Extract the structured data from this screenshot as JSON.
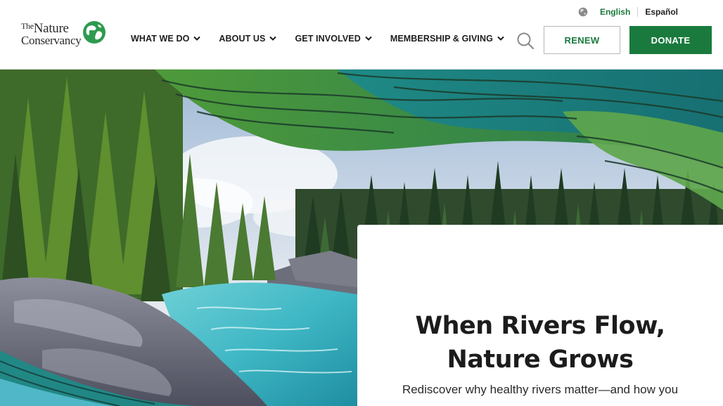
{
  "brand": {
    "logo_line1_small": "The",
    "logo_line1": "Nature",
    "logo_line2": "Conservancy",
    "color_green": "#1a7a3e"
  },
  "language": {
    "options": [
      "English",
      "Español"
    ],
    "selected": "English",
    "icon": "globe-icon"
  },
  "nav": {
    "items": [
      {
        "label": "WHAT WE DO",
        "icon": "chevron-down-icon"
      },
      {
        "label": "ABOUT US",
        "icon": "chevron-down-icon"
      },
      {
        "label": "GET INVOLVED",
        "icon": "chevron-down-icon"
      },
      {
        "label": "MEMBERSHIP & GIVING",
        "icon": "chevron-down-icon"
      }
    ],
    "search_icon": "search-icon",
    "renew_label": "RENEW",
    "donate_label": "DONATE"
  },
  "hero": {
    "title_line1": "When Rivers Flow,",
    "title_line2": "Nature Grows",
    "subtitle": "Rediscover why healthy rivers matter—and how you"
  }
}
